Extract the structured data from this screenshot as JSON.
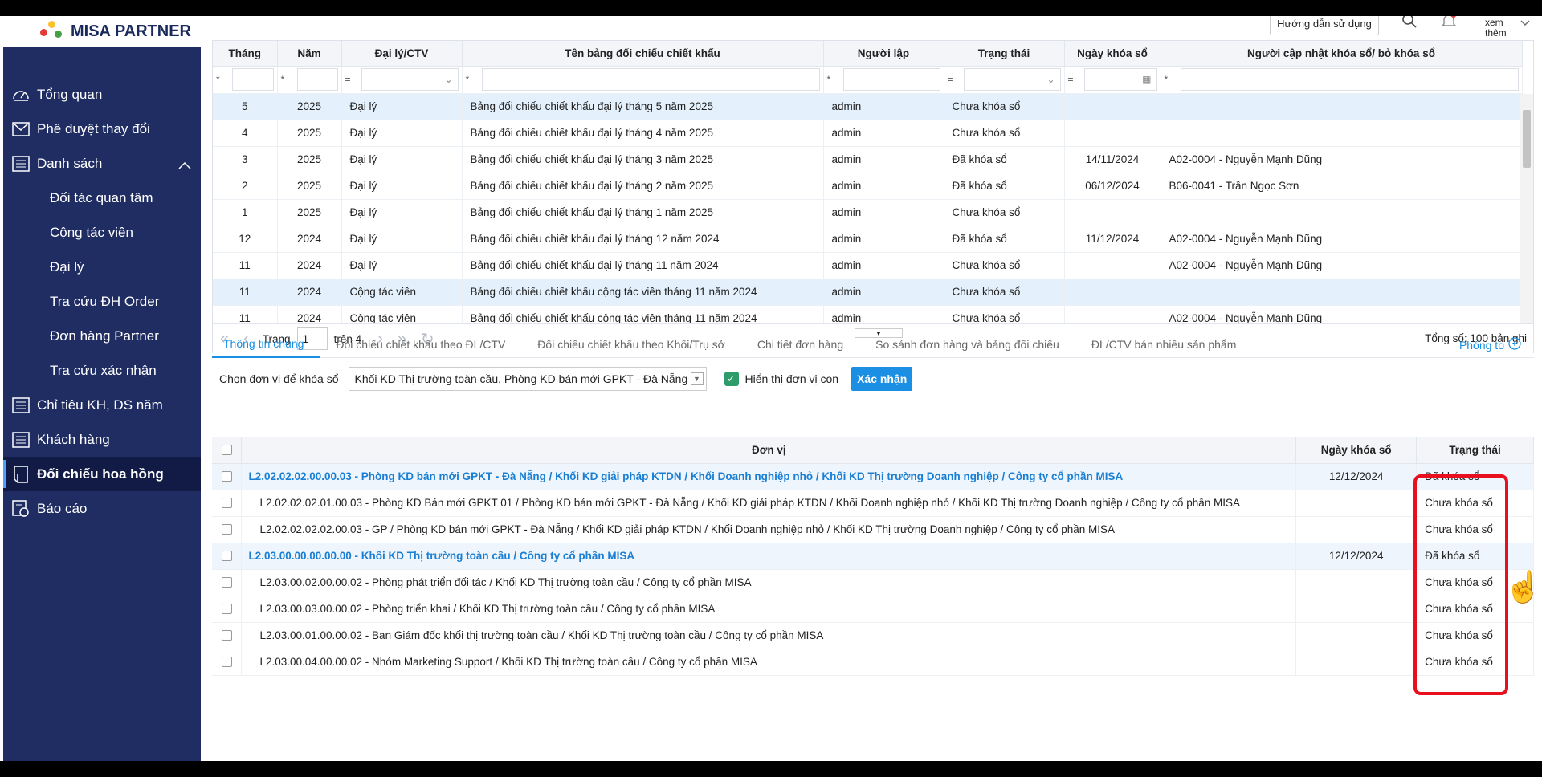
{
  "brand": {
    "name": "MISA PARTNER"
  },
  "topbar": {
    "help_label": "Hướng dẫn sử dụng",
    "more_label": "xem thêm"
  },
  "sidebar": {
    "items": [
      {
        "label": "Tổng quan",
        "icon": "dashboard-icon"
      },
      {
        "label": "Phê duyệt thay đổi",
        "icon": "mail-icon"
      },
      {
        "label": "Danh sách",
        "icon": "list-icon"
      },
      {
        "label": "Đối tác quan tâm"
      },
      {
        "label": "Cộng tác viên"
      },
      {
        "label": "Đại lý"
      },
      {
        "label": "Tra cứu ĐH Order"
      },
      {
        "label": "Đơn hàng Partner"
      },
      {
        "label": "Tra cứu xác nhận"
      },
      {
        "label": "Chỉ tiêu KH, DS năm",
        "icon": "list-icon"
      },
      {
        "label": "Khách hàng",
        "icon": "list-icon"
      },
      {
        "label": "Đối chiếu hoa hồng",
        "icon": "document-icon"
      },
      {
        "label": "Báo cáo",
        "icon": "report-icon"
      }
    ]
  },
  "grid1": {
    "columns": [
      "Tháng",
      "Năm",
      "Đại lý/CTV",
      "Tên bảng đối chiếu chiết khấu",
      "Người lập",
      "Trạng thái",
      "Ngày khóa sổ",
      "Người cập nhật khóa sổ/ bỏ khóa sổ"
    ],
    "filter_ops": [
      "*",
      "*",
      "=",
      "*",
      "*",
      "=",
      "=",
      "*"
    ],
    "rows": [
      [
        "5",
        "2025",
        "Đại lý",
        "Bảng đối chiếu chiết khấu đại lý tháng 5 năm 2025",
        "admin",
        "Chưa khóa sổ",
        "",
        ""
      ],
      [
        "4",
        "2025",
        "Đại lý",
        "Bảng đối chiếu chiết khấu đại lý tháng 4 năm 2025",
        "admin",
        "Chưa khóa sổ",
        "",
        ""
      ],
      [
        "3",
        "2025",
        "Đại lý",
        "Bảng đối chiếu chiết khấu đại lý tháng 3 năm 2025",
        "admin",
        "Đã khóa sổ",
        "14/11/2024",
        "A02-0004 - Nguyễn Mạnh Dũng"
      ],
      [
        "2",
        "2025",
        "Đại lý",
        "Bảng đối chiếu chiết khấu đại lý tháng 2 năm 2025",
        "admin",
        "Đã khóa sổ",
        "06/12/2024",
        "B06-0041 - Trần Ngọc Sơn"
      ],
      [
        "1",
        "2025",
        "Đại lý",
        "Bảng đối chiếu chiết khấu đại lý tháng 1 năm 2025",
        "admin",
        "Chưa khóa sổ",
        "",
        ""
      ],
      [
        "12",
        "2024",
        "Đại lý",
        "Bảng đối chiếu chiết khấu đại lý tháng 12 năm 2024",
        "admin",
        "Đã khóa sổ",
        "11/12/2024",
        "A02-0004 - Nguyễn Mạnh Dũng"
      ],
      [
        "11",
        "2024",
        "Đại lý",
        "Bảng đối chiếu chiết khấu đại lý tháng 11 năm 2024",
        "admin",
        "Chưa khóa sổ",
        "",
        "A02-0004 - Nguyễn Mạnh Dũng"
      ],
      [
        "11",
        "2024",
        "Cộng tác viên",
        "Bảng đối chiếu chiết khấu cộng tác viên tháng 11 năm 2024",
        "admin",
        "Chưa khóa sổ",
        "",
        ""
      ],
      [
        "11",
        "2024",
        "Cộng tác viên",
        "Bảng đối chiếu chiết khấu cộng tác viên tháng 11 năm 2024",
        "admin",
        "Chưa khóa sổ",
        "",
        "A02-0004 - Nguyễn Mạnh Dũng"
      ]
    ],
    "pager": {
      "page_label": "Trang",
      "page_value": "1",
      "of_label": "trên 4",
      "total": "Tổng số: 100 bản ghi"
    }
  },
  "tabs": {
    "items": [
      "Thông tin chung",
      "Đối chiếu chiết khấu theo ĐL/CTV",
      "Đối chiếu chiết khấu theo Khối/Trụ sở",
      "Chi tiết đơn hàng",
      "So sánh đơn hàng và bảng đối chiếu",
      "ĐL/CTV bán nhiều sản phẩm"
    ],
    "zoom_label": "Phóng to"
  },
  "lockbar": {
    "label": "Chọn đơn vị để khóa sổ",
    "selected": "Khối KD Thị trường toàn cầu, Phòng KD bán mới GPKT - Đà Nẵng",
    "show_children": "Hiển thị đơn vị con",
    "confirm": "Xác nhận"
  },
  "grid2": {
    "columns": [
      "Đơn vị",
      "Ngày khóa sổ",
      "Trạng thái"
    ],
    "rows": [
      {
        "unit": "L2.02.02.02.00.00.03 - Phòng KD bán mới GPKT - Đà Nẵng / Khối KD giải pháp KTDN / Khối Doanh nghiệp nhỏ / Khối KD Thị trường Doanh nghiệp / Công ty cổ phần MISA",
        "date": "12/12/2024",
        "status": "Đã khóa sổ",
        "group": true
      },
      {
        "unit": "L2.02.02.02.01.00.03 - Phòng KD Bán mới GPKT 01 / Phòng KD bán mới GPKT - Đà Nẵng / Khối KD giải pháp KTDN / Khối Doanh nghiệp nhỏ / Khối KD Thị trường Doanh nghiệp / Công ty cổ phần MISA",
        "date": "",
        "status": "Chưa khóa sổ",
        "group": false
      },
      {
        "unit": "L2.02.02.02.02.00.03 - GP / Phòng KD bán mới GPKT - Đà Nẵng / Khối KD giải pháp KTDN / Khối Doanh nghiệp nhỏ / Khối KD Thị trường Doanh nghiệp / Công ty cổ phần MISA",
        "date": "",
        "status": "Chưa khóa sổ",
        "group": false
      },
      {
        "unit": "L2.03.00.00.00.00.00 - Khối KD Thị trường toàn cầu / Công ty cổ phần MISA",
        "date": "12/12/2024",
        "status": "Đã khóa sổ",
        "group": true
      },
      {
        "unit": "L2.03.00.02.00.00.02 - Phòng phát triển đối tác / Khối KD Thị trường toàn cầu / Công ty cổ phần MISA",
        "date": "",
        "status": "Chưa khóa sổ",
        "group": false
      },
      {
        "unit": "L2.03.00.03.00.00.02 - Phòng triển khai / Khối KD Thị trường toàn cầu / Công ty cổ phần MISA",
        "date": "",
        "status": "Chưa khóa sổ",
        "group": false
      },
      {
        "unit": "L2.03.00.01.00.00.02 - Ban Giám đốc khối thị trường toàn cầu / Khối KD Thị trường toàn cầu / Công ty cổ phần MISA",
        "date": "",
        "status": "Chưa khóa sổ",
        "group": false
      },
      {
        "unit": "L2.03.00.04.00.00.02 - Nhóm Marketing Support / Khối KD Thị trường toàn cầu / Công ty cổ phần MISA",
        "date": "",
        "status": "Chưa khóa sổ",
        "group": false
      }
    ]
  },
  "colors": {
    "sidebar_bg": "#1f2d63",
    "accent": "#1a8fe3",
    "highlight_border": "#e8101f",
    "checkbox_on": "#2e9c6a"
  }
}
